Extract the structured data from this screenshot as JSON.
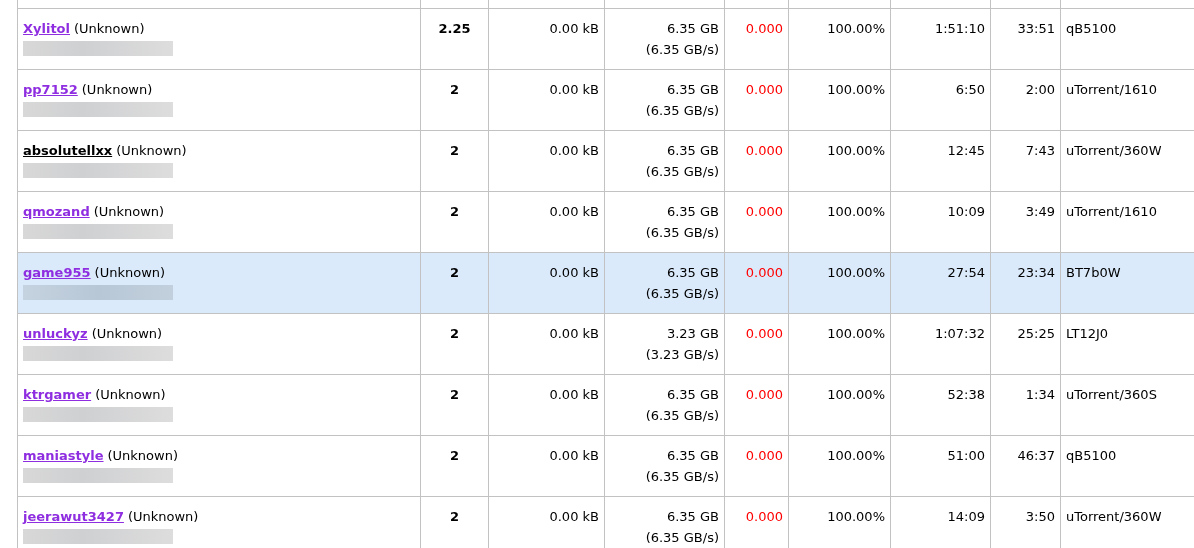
{
  "peers": [
    {
      "user": "Xylitol",
      "user_visited": true,
      "status": "(Unknown)",
      "address_redacted": true,
      "ratio": "2.25",
      "uploaded": "0.00 kB",
      "downloaded": "6.35 GB",
      "download_rate": "(6.35 GB/s)",
      "share": "0.000",
      "complete": "100.00%",
      "connected": "1:51:10",
      "idle": "33:51",
      "client": "qB5100",
      "selected": false
    },
    {
      "user": "pp7152",
      "user_visited": true,
      "status": "(Unknown)",
      "address_redacted": true,
      "ratio": "2",
      "uploaded": "0.00 kB",
      "downloaded": "6.35 GB",
      "download_rate": "(6.35 GB/s)",
      "share": "0.000",
      "complete": "100.00%",
      "connected": "6:50",
      "idle": "2:00",
      "client": "uTorrent/1610",
      "selected": false
    },
    {
      "user": "absolutellxx",
      "user_visited": false,
      "status": "(Unknown)",
      "address_redacted": true,
      "ratio": "2",
      "uploaded": "0.00 kB",
      "downloaded": "6.35 GB",
      "download_rate": "(6.35 GB/s)",
      "share": "0.000",
      "complete": "100.00%",
      "connected": "12:45",
      "idle": "7:43",
      "client": "uTorrent/360W",
      "selected": false
    },
    {
      "user": "qmozand",
      "user_visited": true,
      "status": "(Unknown)",
      "address_redacted": true,
      "ratio": "2",
      "uploaded": "0.00 kB",
      "downloaded": "6.35 GB",
      "download_rate": "(6.35 GB/s)",
      "share": "0.000",
      "complete": "100.00%",
      "connected": "10:09",
      "idle": "3:49",
      "client": "uTorrent/1610",
      "selected": false
    },
    {
      "user": "game955",
      "user_visited": true,
      "status": "(Unknown)",
      "address_redacted": true,
      "ratio": "2",
      "uploaded": "0.00 kB",
      "downloaded": "6.35 GB",
      "download_rate": "(6.35 GB/s)",
      "share": "0.000",
      "complete": "100.00%",
      "connected": "27:54",
      "idle": "23:34",
      "client": "BT7b0W",
      "selected": true
    },
    {
      "user": "unluckyz",
      "user_visited": true,
      "status": "(Unknown)",
      "address_redacted": true,
      "ratio": "2",
      "uploaded": "0.00 kB",
      "downloaded": "3.23 GB",
      "download_rate": "(3.23 GB/s)",
      "share": "0.000",
      "complete": "100.00%",
      "connected": "1:07:32",
      "idle": "25:25",
      "client": "LT12J0",
      "selected": false
    },
    {
      "user": "ktrgamer",
      "user_visited": true,
      "status": "(Unknown)",
      "address_redacted": true,
      "ratio": "2",
      "uploaded": "0.00 kB",
      "downloaded": "6.35 GB",
      "download_rate": "(6.35 GB/s)",
      "share": "0.000",
      "complete": "100.00%",
      "connected": "52:38",
      "idle": "1:34",
      "client": "uTorrent/360S",
      "selected": false
    },
    {
      "user": "maniastyle",
      "user_visited": true,
      "status": "(Unknown)",
      "address_redacted": true,
      "ratio": "2",
      "uploaded": "0.00 kB",
      "downloaded": "6.35 GB",
      "download_rate": "(6.35 GB/s)",
      "share": "0.000",
      "complete": "100.00%",
      "connected": "51:00",
      "idle": "46:37",
      "client": "qB5100",
      "selected": false
    },
    {
      "user": "jeerawut3427",
      "user_visited": true,
      "status": "(Unknown)",
      "address_redacted": true,
      "ratio": "2",
      "uploaded": "0.00 kB",
      "downloaded": "6.35 GB",
      "download_rate": "(6.35 GB/s)",
      "share": "0.000",
      "complete": "100.00%",
      "connected": "14:09",
      "idle": "3:50",
      "client": "uTorrent/360W",
      "selected": false
    }
  ]
}
